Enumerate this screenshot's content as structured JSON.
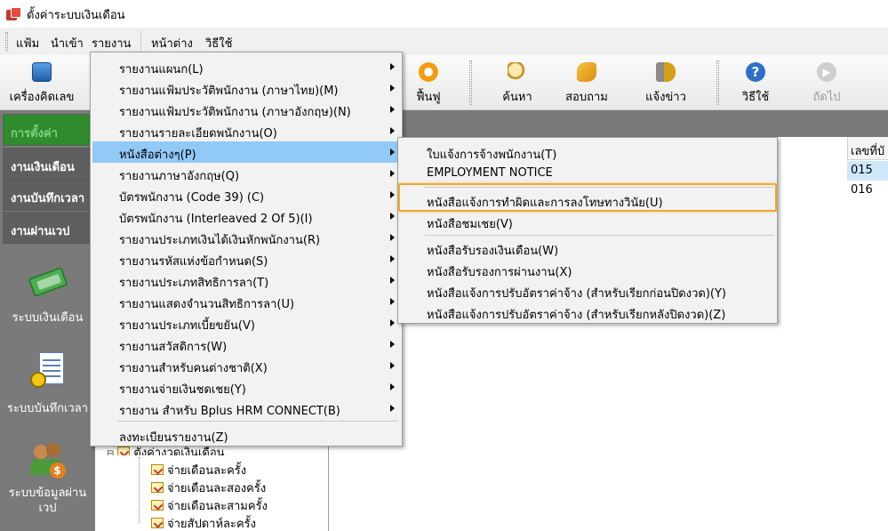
{
  "window": {
    "title": "ตั้งค่าระบบเงินเดือน"
  },
  "menubar": {
    "items": [
      "แฟ้ม",
      "นำเข้า",
      "รายงาน",
      "หน้าต่าง",
      "วิธีใช้"
    ]
  },
  "toolbar": {
    "calculator": "เครื่องคิดเลข",
    "restore": "ฟื้นฟู",
    "search": "ค้นหา",
    "inquire": "สอบถาม",
    "notify": "แจ้งข่าว",
    "help": "วิธีใช้",
    "next": "ถัดไป"
  },
  "leftnav": {
    "tabs": [
      "การตั้งค่า",
      "งานเงินเดือน",
      "งานบันทึกเวลา",
      "งานผ่านเวป"
    ],
    "modules": [
      "ระบบเงินเดือน",
      "ระบบบันทึกเวลา",
      "ระบบข้อมูลผ่าน\nเวป"
    ]
  },
  "report_menu": {
    "items": [
      "รายงานแผนก(L)",
      "รายงานแฟ้มประวัติพนักงาน (ภาษาไทย)(M)",
      "รายงานแฟ้มประวัติพนักงาน (ภาษาอังกฤษ)(N)",
      "รายงานรายละเอียดพนักงาน(O)",
      "หนังสือต่างๆ(P)",
      "รายงานภาษาอังกฤษ(Q)",
      "บัตรพนักงาน (Code 39) (C)",
      "บัตรพนักงาน (Interleaved 2 Of 5)(I)",
      "รายงานประเภทเงินได้เงินหักพนักงาน(R)",
      "รายงานรหัสแห่งข้อกำหนด(S)",
      "รายงานประเภทสิทธิการลา(T)",
      "รายงานแสดงจำนวนสิทธิการลา(U)",
      "รายงานประเภทเบี้ยขยัน(V)",
      "รายงานสวัสดิการ(W)",
      "รายงานสำหรับคนต่างชาติ(X)",
      "รายงานจ่ายเงินชดเชย(Y)",
      "รายงาน สำหรับ Bplus HRM CONNECT(B)"
    ],
    "footer": "ลงทะเบียนรายงาน(Z)"
  },
  "letters_submenu": {
    "items": [
      "ใบแจ้งการจ้างพนักงาน(T)",
      "EMPLOYMENT NOTICE",
      "หนังสือแจ้งการทำผิดและการลงโทษทางวินัย(U)",
      "หนังสือชมเชย(V)",
      "หนังสือรับรองเงินเดือน(W)",
      "หนังสือรับรองการผ่านงาน(X)",
      "หนังสือแจ้งการปรับอัตราค่าจ้าง (สำหรับเรียกก่อนปิดงวด)(Y)",
      "หนังสือแจ้งการปรับอัตราค่าจ้าง (สำหรับเรียกหลังปิดงวด)(Z)"
    ]
  },
  "grid": {
    "header": "เลขที่บั",
    "values": [
      "015",
      "016"
    ]
  },
  "tree": {
    "parent": "ตั้งค่างวดเงินเดือน",
    "children": [
      "จ่ายเดือนละครั้ง",
      "จ่ายเดือนละสองครั้ง",
      "จ่ายเดือนละสามครั้ง",
      "จ่ายสัปดาห์ละครั้ง"
    ]
  },
  "colors": {
    "menu_highlight": "#91c9f7",
    "callout": "#f0a830",
    "active_tab": "#2e8b2e"
  }
}
